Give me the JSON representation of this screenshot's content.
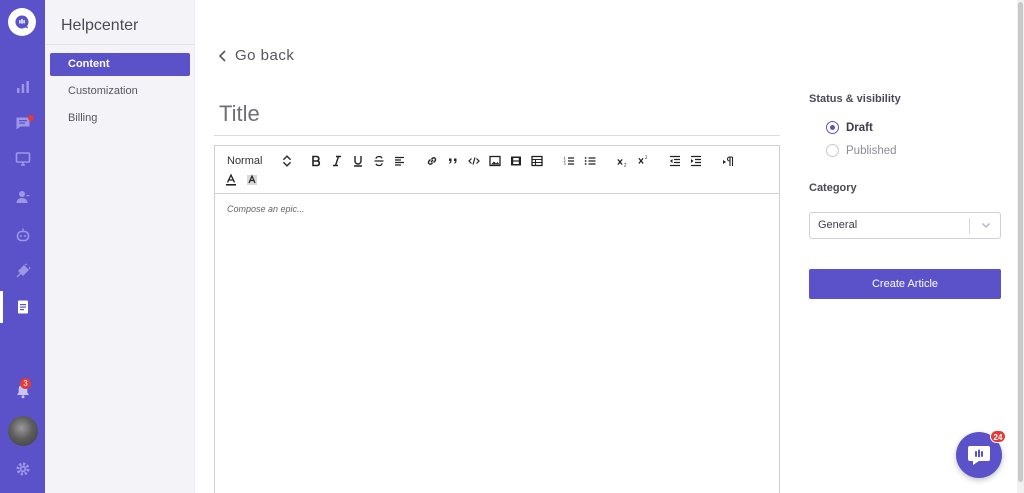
{
  "sidebar": {
    "title": "Helpcenter",
    "items": [
      {
        "label": "Content",
        "active": true
      },
      {
        "label": "Customization",
        "active": false
      },
      {
        "label": "Billing",
        "active": false
      }
    ]
  },
  "rail": {
    "icons": [
      "analytics-icon",
      "conversations-icon",
      "monitor-icon",
      "contacts-icon",
      "bot-icon",
      "integrations-icon",
      "helpcenter-icon"
    ],
    "notifications_count": "3"
  },
  "main": {
    "go_back": "Go back",
    "title_placeholder": "Title",
    "editor_placeholder": "Compose an epic...",
    "heading_select": "Normal"
  },
  "panel": {
    "status_label": "Status & visibility",
    "status_options": [
      {
        "label": "Draft",
        "checked": true
      },
      {
        "label": "Published",
        "checked": false
      }
    ],
    "category_label": "Category",
    "category_value": "General",
    "create_button": "Create Article"
  },
  "chat": {
    "badge": "24"
  },
  "colors": {
    "accent": "#5b52c9",
    "badge": "#e53935"
  }
}
